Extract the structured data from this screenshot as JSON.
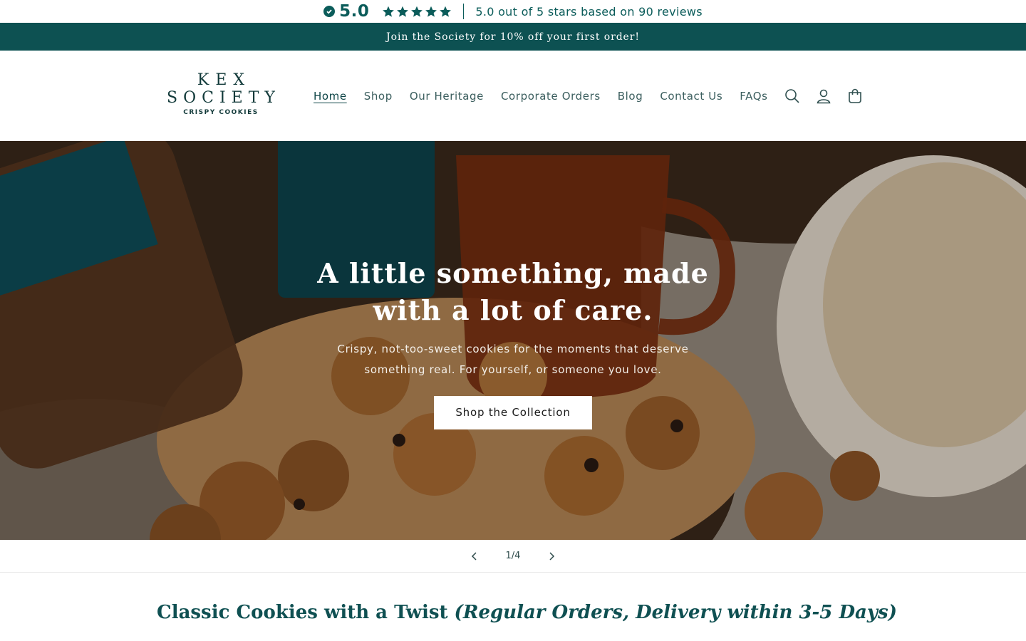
{
  "reviews": {
    "score": "5.0",
    "stars": 5,
    "summary": "5.0 out of 5 stars based on 90 reviews",
    "color": "#0b5c5a"
  },
  "announcement": {
    "text": "Join the Society for 10% off your first order!",
    "background": "#0d5152"
  },
  "logo": {
    "line1": "KEX",
    "line2": "SOCIETY",
    "line3": "CRISPY COOKIES"
  },
  "nav": {
    "items": [
      {
        "label": "Home",
        "active": true
      },
      {
        "label": "Shop"
      },
      {
        "label": "Our Heritage"
      },
      {
        "label": "Corporate Orders"
      },
      {
        "label": "Blog"
      },
      {
        "label": "Contact Us"
      },
      {
        "label": "FAQs"
      }
    ]
  },
  "header_icons": [
    "search-icon",
    "account-icon",
    "cart-icon"
  ],
  "hero": {
    "title_line1": "A little something, made",
    "title_line2": "with a lot of care.",
    "subtitle": "Crispy, not-too-sweet cookies for the moments that deserve something real. For yourself, or someone you love.",
    "button_label": "Shop the Collection"
  },
  "slider": {
    "counter": "1/4"
  },
  "section": {
    "heading_plain": "Classic Cookies with a Twist",
    "heading_emphasis": "(Regular Orders, Delivery within 3-5 Days)"
  }
}
